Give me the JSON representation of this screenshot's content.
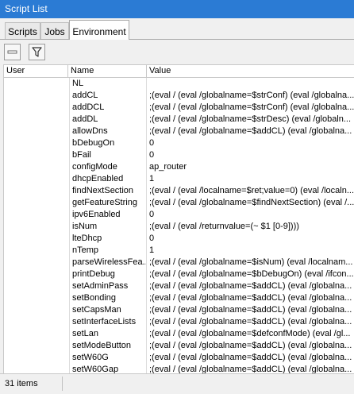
{
  "window": {
    "title": "Script List"
  },
  "tabs": [
    {
      "label": "Scripts"
    },
    {
      "label": "Jobs"
    },
    {
      "label": "Environment",
      "active": true
    }
  ],
  "toolbar": {
    "remove_icon": "minus-icon",
    "filter_icon": "filter-icon"
  },
  "table": {
    "columns": [
      "User",
      "Name",
      "Value"
    ],
    "rows": [
      {
        "user": "",
        "name": "NL",
        "value": ""
      },
      {
        "user": "",
        "name": "addCL",
        "value": ";(eval / (eval /globalname=$strConf) (eval /globalna..."
      },
      {
        "user": "",
        "name": "addDCL",
        "value": ";(eval / (eval /globalname=$strConf) (eval /globalna..."
      },
      {
        "user": "",
        "name": "addDL",
        "value": ";(eval / (eval /globalname=$strDesc) (eval /globaln..."
      },
      {
        "user": "",
        "name": "allowDns",
        "value": ";(eval / (eval /globalname=$addCL) (eval /globalna..."
      },
      {
        "user": "",
        "name": "bDebugOn",
        "value": "0"
      },
      {
        "user": "",
        "name": "bFail",
        "value": "0"
      },
      {
        "user": "",
        "name": "configMode",
        "value": "ap_router"
      },
      {
        "user": "",
        "name": "dhcpEnabled",
        "value": "1"
      },
      {
        "user": "",
        "name": "findNextSection",
        "value": ";(eval / (eval /localname=$ret;value=0) (eval /localn..."
      },
      {
        "user": "",
        "name": "getFeatureString",
        "value": ";(eval / (eval /globalname=$findNextSection) (eval /..."
      },
      {
        "user": "",
        "name": "ipv6Enabled",
        "value": "0"
      },
      {
        "user": "",
        "name": "isNum",
        "value": ";(eval / (eval /returnvalue=(~ $1 [0-9])))"
      },
      {
        "user": "",
        "name": "lteDhcp",
        "value": "0"
      },
      {
        "user": "",
        "name": "nTemp",
        "value": "1"
      },
      {
        "user": "",
        "name": "parseWirelessFea...",
        "value": ";(eval / (eval /globalname=$isNum) (eval /localnam..."
      },
      {
        "user": "",
        "name": "printDebug",
        "value": ";(eval / (eval /globalname=$bDebugOn) (eval /ifcon..."
      },
      {
        "user": "",
        "name": "setAdminPass",
        "value": ";(eval / (eval /globalname=$addCL) (eval /globalna..."
      },
      {
        "user": "",
        "name": "setBonding",
        "value": ";(eval / (eval /globalname=$addCL) (eval /globalna..."
      },
      {
        "user": "",
        "name": "setCapsMan",
        "value": ";(eval / (eval /globalname=$addCL) (eval /globalna..."
      },
      {
        "user": "",
        "name": "setInterfaceLists",
        "value": ";(eval / (eval /globalname=$addCL) (eval /globalna..."
      },
      {
        "user": "",
        "name": "setLan",
        "value": ";(eval / (eval /globalname=$defconfMode) (eval /gl..."
      },
      {
        "user": "",
        "name": "setModeButton",
        "value": ";(eval / (eval /globalname=$addCL) (eval /globalna..."
      },
      {
        "user": "",
        "name": "setW60G",
        "value": ";(eval / (eval /globalname=$addCL) (eval /globalna..."
      },
      {
        "user": "",
        "name": "setW60Gap",
        "value": ";(eval / (eval /globalname=$addCL) (eval /globalna..."
      }
    ]
  },
  "status": {
    "items_count": "31 items"
  }
}
